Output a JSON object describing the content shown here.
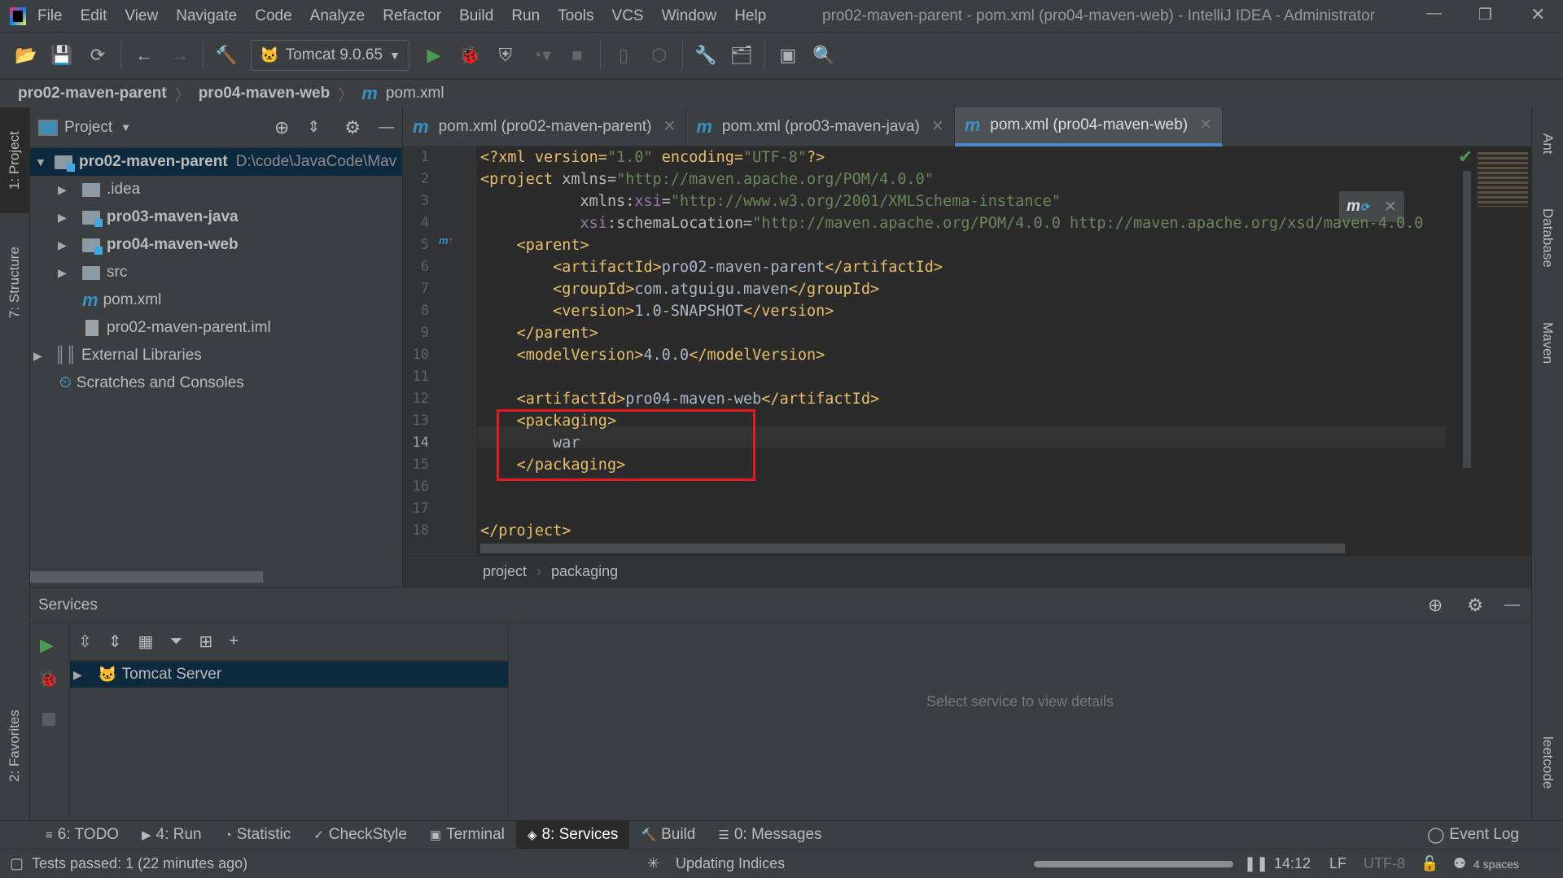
{
  "window": {
    "title": "pro02-maven-parent - pom.xml (pro04-maven-web) - IntelliJ IDEA - Administrator"
  },
  "menu": [
    "File",
    "Edit",
    "View",
    "Navigate",
    "Code",
    "Analyze",
    "Refactor",
    "Build",
    "Run",
    "Tools",
    "VCS",
    "Window",
    "Help"
  ],
  "toolbar": {
    "run_config": "Tomcat 9.0.65"
  },
  "navbar": [
    "pro02-maven-parent",
    "pro04-maven-web",
    "pom.xml"
  ],
  "left_stripe": {
    "project": "1: Project",
    "structure": "7: Structure",
    "favorites": "2: Favorites"
  },
  "right_stripe": {
    "ant": "Ant",
    "database": "Database",
    "maven": "Maven",
    "leetcode": "leetcode"
  },
  "project": {
    "title": "Project",
    "items": [
      {
        "label": "pro02-maven-parent",
        "path": "D:\\code\\JavaCode\\Mav"
      },
      {
        "label": ".idea"
      },
      {
        "label": "pro03-maven-java"
      },
      {
        "label": "pro04-maven-web"
      },
      {
        "label": "src"
      },
      {
        "label": "pom.xml"
      },
      {
        "label": "pro02-maven-parent.iml"
      },
      {
        "label": "External Libraries"
      },
      {
        "label": "Scratches and Consoles"
      }
    ]
  },
  "tabs": [
    {
      "label": "pom.xml (pro02-maven-parent)"
    },
    {
      "label": "pom.xml (pro03-maven-java)"
    },
    {
      "label": "pom.xml (pro04-maven-web)",
      "active": true
    }
  ],
  "editor": {
    "lines": [
      "1",
      "2",
      "3",
      "4",
      "5",
      "6",
      "7",
      "8",
      "9",
      "10",
      "11",
      "12",
      "13",
      "14",
      "15",
      "16",
      "17",
      "18"
    ],
    "code": {
      "l1a": "<?xml version=",
      "l1b": "\"1.0\"",
      " l1c": " encoding=",
      "l1d": "\"UTF-8\"",
      "l1e": "?>",
      "l2a": "<project ",
      "l2b": "xmlns=",
      "l2c": "\"http://maven.apache.org/POM/4.0.0\"",
      "l3a": "xmlns:",
      "l3b": "xsi",
      "l3c": "=",
      "l3d": "\"http://www.w3.org/2001/XMLSchema-instance\"",
      "l4a": "xsi",
      "l4b": ":schemaLocation=",
      "l4c": "\"http://maven.apache.org/POM/4.0.0 http://maven.apache.org/xsd/maven-4.0.0",
      "l5": "<parent>",
      "l6a": "<artifactId>",
      "l6b": "pro02-maven-parent",
      "l6c": "</artifactId>",
      "l7a": "<groupId>",
      "l7b": "com.atguigu.maven",
      "l7c": "</groupId>",
      "l8a": "<version>",
      "l8b": "1.0-SNAPSHOT",
      "l8c": "</version>",
      "l9": "</parent>",
      "l10a": "<modelVersion>",
      "l10b": "4.0.0",
      "l10c": "</modelVersion>",
      "l12a": "<artifactId>",
      "l12b": "pro04-maven-web",
      "l12c": "</artifactId>",
      "l13": "<packaging>",
      "l14": "war",
      "l15": "</packaging>",
      "l18": "</project>"
    },
    "breadcrumb": [
      "project",
      "packaging"
    ]
  },
  "services": {
    "title": "Services",
    "tree": [
      "Tomcat Server"
    ],
    "details_placeholder": "Select service to view details"
  },
  "toolwindows": [
    {
      "label": "6: TODO"
    },
    {
      "label": "4: Run"
    },
    {
      "label": "Statistic"
    },
    {
      "label": "CheckStyle"
    },
    {
      "label": "Terminal"
    },
    {
      "label": "8: Services",
      "active": true
    },
    {
      "label": "Build"
    },
    {
      "label": "0: Messages"
    }
  ],
  "event_log": "Event Log",
  "status": {
    "tests": "Tests passed: 1 (22 minutes ago)",
    "indexing": "Updating Indices",
    "position": "14:12",
    "line_sep": "LF",
    "encoding": "UTF-8",
    "indent": "4 spaces"
  },
  "colors": {
    "accent": "#4a88c7",
    "highlight": "#e5191f",
    "run": "#499c54"
  }
}
